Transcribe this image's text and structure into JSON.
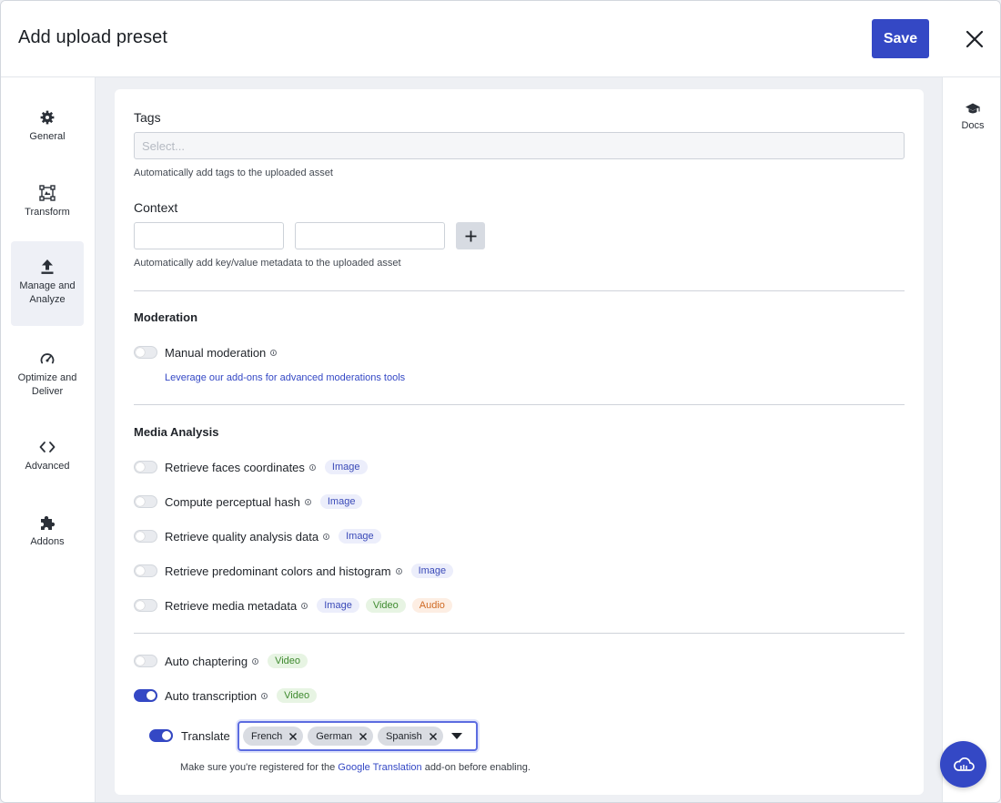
{
  "header": {
    "title": "Add upload preset",
    "save_label": "Save"
  },
  "leftnav": {
    "items": [
      {
        "label": "General",
        "icon": "gear-icon"
      },
      {
        "label": "Transform",
        "icon": "transform-icon"
      },
      {
        "label": "Manage and Analyze",
        "icon": "upload-icon",
        "active": true
      },
      {
        "label": "Optimize and Deliver",
        "icon": "gauge-icon"
      },
      {
        "label": "Advanced",
        "icon": "code-icon"
      },
      {
        "label": "Addons",
        "icon": "puzzle-icon"
      }
    ]
  },
  "rightrail": {
    "docs_label": "Docs"
  },
  "tags": {
    "label": "Tags",
    "placeholder": "Select...",
    "helper": "Automatically add tags to the uploaded asset"
  },
  "context": {
    "label": "Context",
    "key_value": "",
    "value_value": "",
    "helper": "Automatically add key/value metadata to the uploaded asset"
  },
  "moderation": {
    "title": "Moderation",
    "manual_label": "Manual moderation",
    "manual_on": false,
    "link": "Leverage our add-ons for advanced moderations tools"
  },
  "media_analysis": {
    "title": "Media Analysis",
    "items": [
      {
        "label": "Retrieve faces coordinates",
        "on": false,
        "badges": [
          "Image"
        ]
      },
      {
        "label": "Compute perceptual hash",
        "on": false,
        "badges": [
          "Image"
        ]
      },
      {
        "label": "Retrieve quality analysis data",
        "on": false,
        "badges": [
          "Image"
        ]
      },
      {
        "label": "Retrieve predominant colors and histogram",
        "on": false,
        "badges": [
          "Image"
        ]
      },
      {
        "label": "Retrieve media metadata",
        "on": false,
        "badges": [
          "Image",
          "Video",
          "Audio"
        ]
      }
    ]
  },
  "video_features": {
    "auto_chaptering": {
      "label": "Auto chaptering",
      "on": false,
      "badge": "Video"
    },
    "auto_transcription": {
      "label": "Auto transcription",
      "on": true,
      "badge": "Video"
    },
    "translate": {
      "label": "Translate",
      "on": true,
      "languages": [
        "French",
        "German",
        "Spanish"
      ],
      "note_prefix": "Make sure you're registered for the ",
      "note_link": "Google Translation",
      "note_suffix": " add-on before enabling."
    }
  },
  "colors": {
    "accent": "#3448c5",
    "image_badge": "#3a4ab8",
    "video_badge": "#3f8a2f",
    "audio_badge": "#cf6a24"
  }
}
